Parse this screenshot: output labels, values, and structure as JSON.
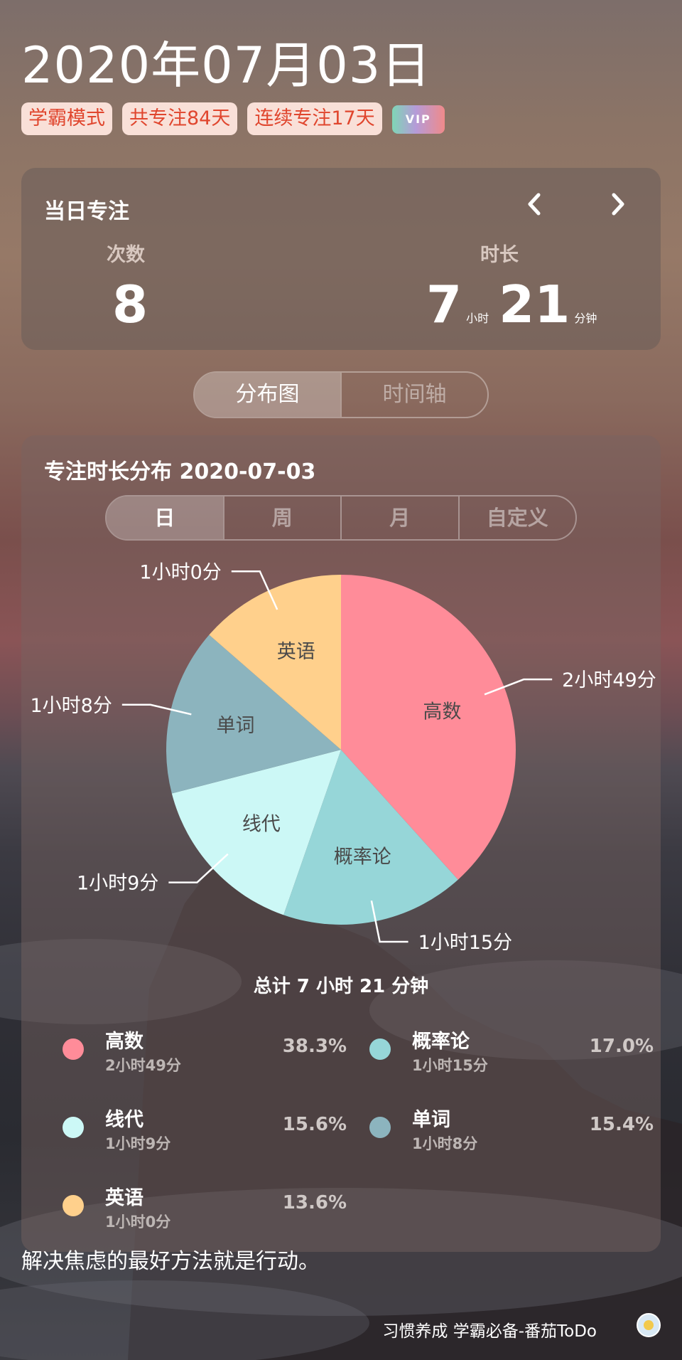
{
  "header": {
    "date": "2020年07月03日",
    "tags": [
      "学霸模式",
      "共专注84天",
      "连续专注17天"
    ],
    "vip": "VIP"
  },
  "daily_focus": {
    "title": "当日专注",
    "count_label": "次数",
    "count_value": "8",
    "duration_label": "时长",
    "hours": "7",
    "hours_unit": "小时",
    "minutes": "21",
    "minutes_unit": "分钟"
  },
  "view_tabs": {
    "distribution": "分布图",
    "timeline": "时间轴",
    "active": "distribution"
  },
  "distribution": {
    "title": "专注时长分布  2020-07-03",
    "ranges": [
      "日",
      "周",
      "月",
      "自定义"
    ],
    "active_range": "日",
    "total": "总计 7 小时 21 分钟"
  },
  "chart_data": {
    "type": "pie",
    "title": "",
    "slices": [
      {
        "name": "高数",
        "duration": "2小时49分",
        "minutes": 169,
        "percent": "38.3%",
        "color": "#ff8c99"
      },
      {
        "name": "概率论",
        "duration": "1小时15分",
        "minutes": 75,
        "percent": "17.0%",
        "color": "#96d6d8"
      },
      {
        "name": "线代",
        "duration": "1小时9分",
        "minutes": 69,
        "percent": "15.6%",
        "color": "#ccf8f6"
      },
      {
        "name": "单词",
        "duration": "1小时8分",
        "minutes": 68,
        "percent": "15.4%",
        "color": "#8cb4be"
      },
      {
        "name": "英语",
        "duration": "1小时0分",
        "minutes": 60,
        "percent": "13.6%",
        "color": "#ffd08c"
      }
    ]
  },
  "footer": {
    "quote": "解决焦虑的最好方法就是行动。",
    "brand": "习惯养成 学霸必备-番茄ToDo"
  }
}
